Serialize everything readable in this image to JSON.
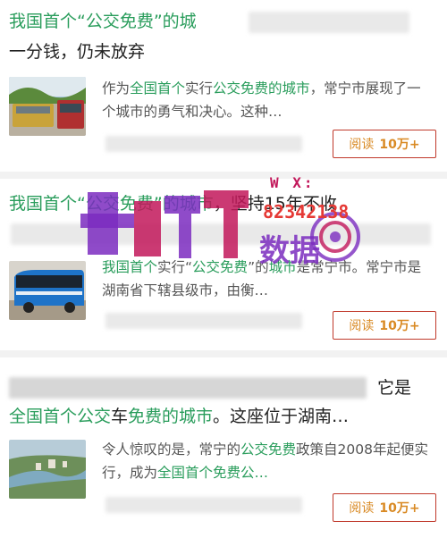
{
  "articles": [
    {
      "title_parts": [
        {
          "text": "我国首个“公交免费”的城",
          "green": true
        }
      ],
      "title_line2": "一分钱，仍未放弃",
      "summary_parts": [
        {
          "text": "作为",
          "green": false
        },
        {
          "text": "全国首个",
          "green": true
        },
        {
          "text": "实行",
          "green": false
        },
        {
          "text": "公交免费的城市",
          "green": true
        },
        {
          "text": "，常宁市展现了一个城市的勇气和决心。这种…",
          "green": false
        }
      ],
      "read_label": "阅读",
      "read_count": "10万+"
    },
    {
      "title_parts": [
        {
          "text": "我国首个",
          "green": true
        },
        {
          "text": "“公交免费”",
          "green": true
        },
        {
          "text": "的城市",
          "green": true
        },
        {
          "text": "，坚持15年不收",
          "green": false
        }
      ],
      "summary_parts": [
        {
          "text": "我国首个",
          "green": true
        },
        {
          "text": "实行“",
          "green": false
        },
        {
          "text": "公交免费",
          "green": true
        },
        {
          "text": "”的",
          "green": false
        },
        {
          "text": "城市",
          "green": true
        },
        {
          "text": "是常宁市。常宁市是湖南省下辖县级市，由衡…",
          "green": false
        }
      ],
      "read_label": "阅读",
      "read_count": "10万+"
    },
    {
      "title_tail": "它是",
      "title_line2_parts": [
        {
          "text": "全国首个公交",
          "green": true
        },
        {
          "text": "车",
          "green": false
        },
        {
          "text": "免费的城市",
          "green": true
        },
        {
          "text": "。这座位于湖南…",
          "green": false
        }
      ],
      "summary_parts": [
        {
          "text": "令人惊叹的是，常宁的",
          "green": false
        },
        {
          "text": "公交免费",
          "green": true
        },
        {
          "text": "政策自2008年起便实行，成为",
          "green": false
        },
        {
          "text": "全国首个免费公…",
          "green": true
        }
      ],
      "read_label": "阅读",
      "read_count": "10万+"
    }
  ],
  "watermark": {
    "text_small": "W X:",
    "text_number": "82342138",
    "text_main": "数据"
  },
  "colors": {
    "accent_green": "#2a9d5c",
    "read_border": "#c0392b",
    "read_text": "#d98a24"
  }
}
